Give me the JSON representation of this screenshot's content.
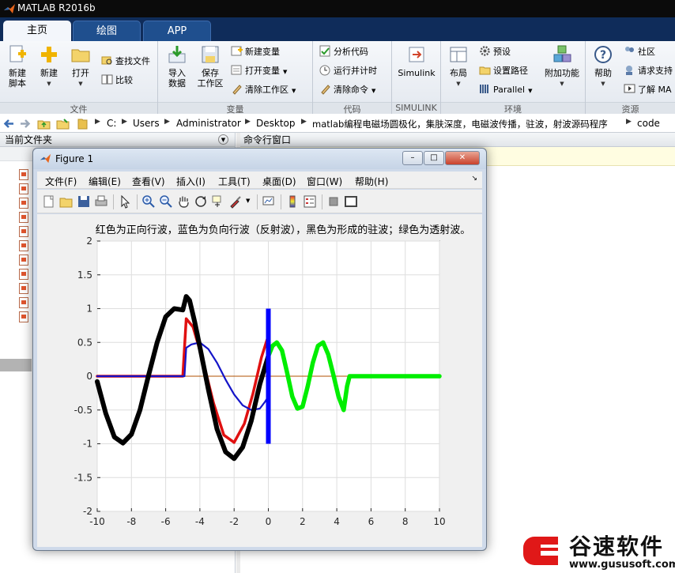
{
  "window": {
    "title": "MATLAB R2016b"
  },
  "tabs": [
    {
      "label": "主页",
      "active": true
    },
    {
      "label": "绘图",
      "active": false
    },
    {
      "label": "APP",
      "active": false
    }
  ],
  "ribbon": {
    "file": {
      "group_label": "文件",
      "new_script": [
        "新建",
        "脚本"
      ],
      "new": "新建",
      "open": "打开",
      "find_files": "查找文件",
      "compare": "比较"
    },
    "variable": {
      "group_label": "变量",
      "import": [
        "导入",
        "数据"
      ],
      "save_ws": [
        "保存",
        "工作区"
      ],
      "new_var": "新建变量",
      "open_var": "打开变量",
      "clear_ws": "清除工作区"
    },
    "code": {
      "group_label": "代码",
      "analyze": "分析代码",
      "run_time": "运行并计时",
      "clear_cmd": "清除命令"
    },
    "simulink": {
      "group_label": "SIMULINK",
      "simulink": "Simulink"
    },
    "env": {
      "group_label": "环境",
      "layout": "布局",
      "prefs": "预设",
      "set_path": "设置路径",
      "parallel": "Parallel",
      "addons": "附加功能"
    },
    "resources": {
      "group_label": "资源",
      "help": "帮助",
      "community": "社区",
      "request_support": "请求支持",
      "learn": "了解 MA"
    }
  },
  "address": {
    "crumbs": [
      "C:",
      "Users",
      "Administrator",
      "Desktop",
      "matlab编程电磁场圆极化，集肤深度，电磁波传播，驻波，射波源码程序",
      "code"
    ]
  },
  "panels": {
    "current_folder": "当前文件夹",
    "command_window": "命令行窗口"
  },
  "figure": {
    "title": "Figure 1",
    "menu": [
      "文件(F)",
      "编辑(E)",
      "查看(V)",
      "插入(I)",
      "工具(T)",
      "桌面(D)",
      "窗口(W)",
      "帮助(H)"
    ],
    "plot_title": "红色为正向行波，蓝色为负向行波（反射波），黑色为形成的驻波；绿色为透射波。"
  },
  "chart_data": {
    "type": "line",
    "title": "红色为正向行波，蓝色为负向行波（反射波），黑色为形成的驻波；绿色为透射波。",
    "xlabel": "",
    "ylabel": "",
    "xlim": [
      -10,
      10
    ],
    "ylim": [
      -2,
      2
    ],
    "xticks": [
      -10,
      -8,
      -6,
      -4,
      -2,
      0,
      2,
      4,
      6,
      8,
      10
    ],
    "yticks": [
      -2,
      -1.5,
      -1,
      -0.5,
      0,
      0.5,
      1,
      1.5,
      2
    ],
    "grid": true,
    "series": [
      {
        "color": "#e01010",
        "x": [
          -10,
          -5,
          -4.8,
          -4.4,
          -3.8,
          -3.2,
          -2.6,
          -2.0,
          -1.4,
          -0.9,
          -0.4,
          0
        ],
        "y": [
          0,
          0,
          0.85,
          0.73,
          0.21,
          -0.4,
          -0.87,
          -0.98,
          -0.7,
          -0.26,
          0.28,
          0.6
        ]
      },
      {
        "color": "#1414c8",
        "x": [
          -10,
          -4.9,
          -4.8,
          -4.5,
          -4.0,
          -3.5,
          -3.0,
          -2.5,
          -2.0,
          -1.5,
          -1.0,
          -0.5,
          -0.2,
          0
        ],
        "y": [
          0,
          0,
          0.42,
          0.47,
          0.5,
          0.4,
          0.2,
          -0.05,
          -0.27,
          -0.43,
          -0.5,
          -0.48,
          -0.38,
          -0.3
        ]
      },
      {
        "color": "#000000",
        "x": [
          -10,
          -9.5,
          -9.0,
          -8.5,
          -8.0,
          -7.5,
          -7.0,
          -6.5,
          -6.0,
          -5.5,
          -5.0,
          -4.8,
          -4.6,
          -4.3,
          -4.0,
          -3.5,
          -3.0,
          -2.5,
          -2.0,
          -1.5,
          -1.0,
          -0.5,
          0
        ],
        "y": [
          -0.08,
          -0.55,
          -0.9,
          -0.99,
          -0.86,
          -0.5,
          0.01,
          0.5,
          0.88,
          1.0,
          0.98,
          1.18,
          1.12,
          0.8,
          0.43,
          -0.2,
          -0.78,
          -1.12,
          -1.22,
          -1.05,
          -0.66,
          -0.12,
          0.3
        ]
      },
      {
        "color": "#00ee00",
        "x": [
          0,
          0.25,
          0.5,
          0.8,
          1.1,
          1.4,
          1.7,
          2.0,
          2.3,
          2.6,
          2.9,
          3.2,
          3.5,
          3.8,
          4.1,
          4.4,
          4.6,
          4.75,
          5,
          10
        ],
        "y": [
          0.3,
          0.45,
          0.5,
          0.38,
          0.05,
          -0.3,
          -0.48,
          -0.45,
          -0.15,
          0.2,
          0.45,
          0.5,
          0.32,
          0.02,
          -0.3,
          -0.5,
          -0.15,
          0,
          0,
          0
        ]
      }
    ],
    "boundary_line": {
      "color": "#0000ff",
      "x": 0,
      "y": [
        -1,
        1
      ]
    },
    "zero_line": {
      "color": "#b05000",
      "y": 0,
      "x": [
        -10,
        10
      ]
    }
  },
  "brand": {
    "name": "谷速软件",
    "url": "www.gususoft.com"
  }
}
